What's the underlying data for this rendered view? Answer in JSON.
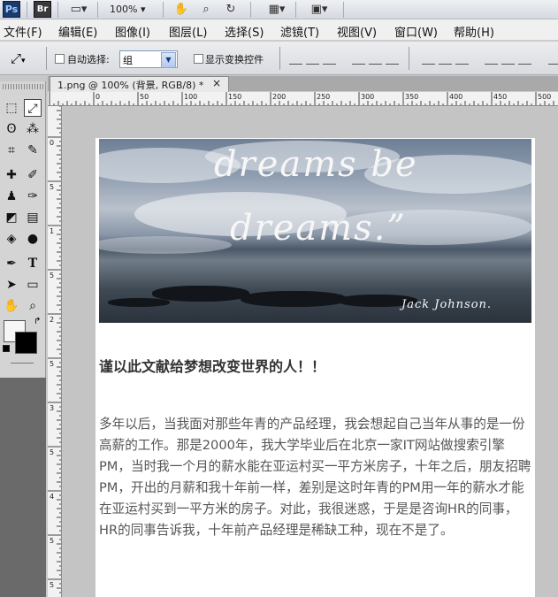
{
  "toolbar": {
    "app_icon": "Ps",
    "bridge_icon": "Br",
    "zoom": "100%",
    "icons": [
      "screen-mode-icon",
      "hand-icon",
      "zoom-icon",
      "rotate-view-icon",
      "arrange-documents-icon",
      "screen-layout-icon"
    ]
  },
  "menu": [
    "文件(F)",
    "编辑(E)",
    "图像(I)",
    "图层(L)",
    "选择(S)",
    "滤镜(T)",
    "视图(V)",
    "窗口(W)",
    "帮助(H)"
  ],
  "options": {
    "auto_select_label": "自动选择:",
    "auto_select_value": "组",
    "show_transform_label": "显示变换控件"
  },
  "document": {
    "tab_title": "1.png @ 100% (背景, RGB/8) *",
    "close": "×"
  },
  "rulers": {
    "h_ticks": [
      "0",
      "50",
      "100",
      "150",
      "200",
      "250",
      "300",
      "350",
      "400",
      "450",
      "500"
    ],
    "v_ticks": [
      "0",
      "5",
      "1",
      "5",
      "2",
      "5",
      "3",
      "5",
      "4",
      "5",
      "5"
    ]
  },
  "hero": {
    "line1": "dreams be",
    "line2": "dreams.”",
    "signature": "Jack Johnson."
  },
  "article": {
    "heading": "谨以此文献给梦想改变世界的人！！",
    "paragraph": "多年以后，当我面对那些年青的产品经理，我会想起自己当年从事的是一份高薪的工作。那是2000年，我大学毕业后在北京一家IT网站做搜索引擎PM，当时我一个月的薪水能在亚运村买一平方米房子，十年之后，朋友招聘PM，开出的月薪和我十年前一样，差别是这时年青的PM用一年的薪水才能在亚运村买到一平方米的房子。对此，我很迷惑，于是是咨询HR的同事，HR的同事告诉我，十年前产品经理是稀缺工种，现在不是了。"
  },
  "colors": {
    "canvas": "#ffffff",
    "pasteboard": "#c4c4c4",
    "toolbox": "#d4d4d4",
    "ps_blue": "#1c3a6e"
  }
}
